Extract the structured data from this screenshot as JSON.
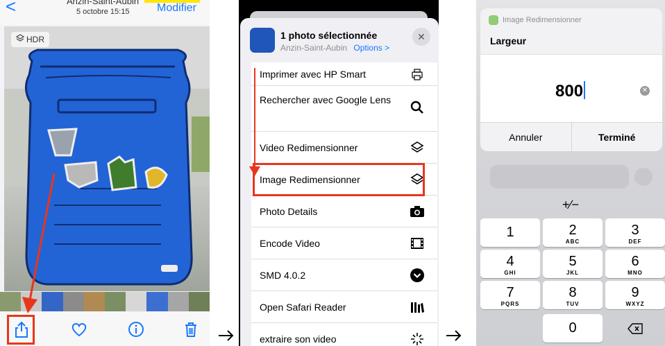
{
  "photos": {
    "back_glyph": "<",
    "place": "Anzin-Saint-Aubin",
    "date": "5 octobre 15:15",
    "edit_label": "Modifier",
    "hdr_badge": "HDR",
    "toolbar_icons": [
      "share-icon",
      "heart-icon",
      "info-icon",
      "trash-icon"
    ]
  },
  "share_sheet": {
    "title": "1 photo sélectionnée",
    "subtitle": "Anzin-Saint-Aubin",
    "options_label": "Options >",
    "close_glyph": "✕",
    "actions": [
      {
        "label": "Imprimer avec HP Smart",
        "icon": "printer-icon"
      },
      {
        "label": "Rechercher avec Google Lens",
        "icon": "search-icon"
      },
      {
        "label": "Video Redimensionner",
        "icon": "shortcuts-icon"
      },
      {
        "label": "Image Redimensionner",
        "icon": "shortcuts-icon"
      },
      {
        "label": "Photo Details",
        "icon": "camera-icon"
      },
      {
        "label": "Encode Video",
        "icon": "film-icon"
      },
      {
        "label": "SMD 4.0.2",
        "icon": "chevron-down-circle-icon"
      },
      {
        "label": "Open Safari Reader",
        "icon": "library-icon"
      },
      {
        "label": "extraire son video",
        "icon": "sparkle-icon"
      }
    ]
  },
  "resize_dialog": {
    "app_name": "Image Redimensionner",
    "field_label": "Largeur",
    "value": "800",
    "cancel_label": "Annuler",
    "done_label": "Terminé",
    "sign_key": "+∕−",
    "keys": [
      {
        "digit": "1",
        "letters": ""
      },
      {
        "digit": "2",
        "letters": "ABC"
      },
      {
        "digit": "3",
        "letters": "DEF"
      },
      {
        "digit": "4",
        "letters": "GHI"
      },
      {
        "digit": "5",
        "letters": "JKL"
      },
      {
        "digit": "6",
        "letters": "MNO"
      },
      {
        "digit": "7",
        "letters": "PQRS"
      },
      {
        "digit": "8",
        "letters": "TUV"
      },
      {
        "digit": "9",
        "letters": "WXYZ"
      },
      {
        "digit": "0",
        "letters": ""
      }
    ]
  },
  "colors": {
    "ios_blue": "#1677ff",
    "annotation_red": "#e8361b",
    "bin_blue": "#1f56b8"
  }
}
